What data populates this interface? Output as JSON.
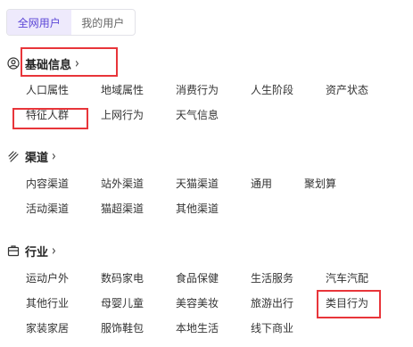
{
  "tabs": [
    {
      "label": "全网用户",
      "active": true
    },
    {
      "label": "我的用户",
      "active": false
    }
  ],
  "sections": [
    {
      "key": "basic",
      "icon": "user-circle-icon",
      "title": "基础信息",
      "items": [
        "人口属性",
        "地域属性",
        "消费行为",
        "人生阶段",
        "资产状态",
        "特征人群",
        "上网行为",
        "天气信息"
      ]
    },
    {
      "key": "channel",
      "icon": "channel-icon",
      "title": "渠道",
      "items": [
        "内容渠道",
        "站外渠道",
        "天猫渠道",
        "通用",
        "聚划算",
        "活动渠道",
        "猫超渠道",
        "其他渠道"
      ]
    },
    {
      "key": "industry",
      "icon": "briefcase-icon",
      "title": "行业",
      "items": [
        "运动户外",
        "数码家电",
        "食品保健",
        "生活服务",
        "汽车汽配",
        "其他行业",
        "母婴儿童",
        "美容美妆",
        "旅游出行",
        "类目行为",
        "家装家居",
        "服饰鞋包",
        "本地生活",
        "线下商业"
      ]
    }
  ],
  "colors": {
    "accent": "#5b45d6",
    "highlight": "#e8353a"
  }
}
